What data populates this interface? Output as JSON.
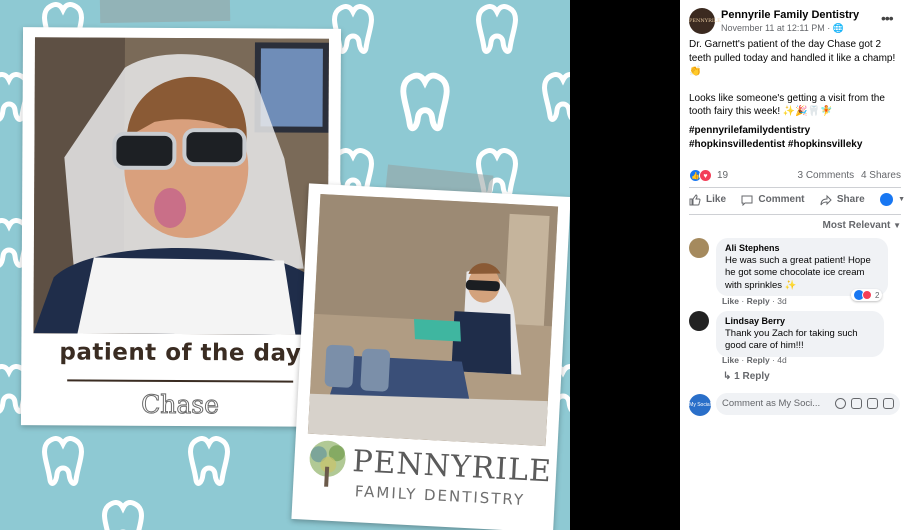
{
  "image": {
    "polaroid1_caption": "patient of the day",
    "polaroid1_name": "Chase",
    "logo_name": "PENNYRILE",
    "logo_sub": "FAMILY DENTISTRY"
  },
  "post": {
    "page_name": "Pennyrile Family Dentistry",
    "page_avatar_text": "PENNYRILE",
    "timestamp": "November 11 at 12:11 PM · ",
    "paragraph1": "Dr. Garnett's patient of the day Chase got 2 teeth pulled today and handled it like a champ! 👏",
    "paragraph2": "Looks like someone's getting a visit from the tooth fairy this week! ✨🎉🦷🧚",
    "hashtag1": "#pennyrilefamilydentistry",
    "hashtag2": "#hopkinsvilledentist #hopkinsvilleky",
    "reaction_count": "19",
    "comments_count": "3 Comments",
    "shares_count": "4 Shares",
    "actions": {
      "like": "Like",
      "comment": "Comment",
      "share": "Share"
    },
    "sort_label": "Most Relevant"
  },
  "comments": [
    {
      "author": "Ali Stephens",
      "text": "He was such a great patient! Hope he got some chocolate ice cream with sprinkles ✨",
      "like": "Like",
      "reply": "Reply",
      "age": "3d",
      "reaction_count": "2"
    },
    {
      "author": "Lindsay Berry",
      "text": "Thank you Zach for taking such good care of him!!!",
      "like": "Like",
      "reply": "Reply",
      "age": "4d"
    }
  ],
  "replies_link": "1 Reply",
  "compose": {
    "placeholder": "Comment as My Soci...",
    "avatar_text": "My Social Practice"
  },
  "colors": {
    "background_teal": "#8ec9d3",
    "fb_blue": "#1877f2",
    "love_red": "#f33e58"
  }
}
